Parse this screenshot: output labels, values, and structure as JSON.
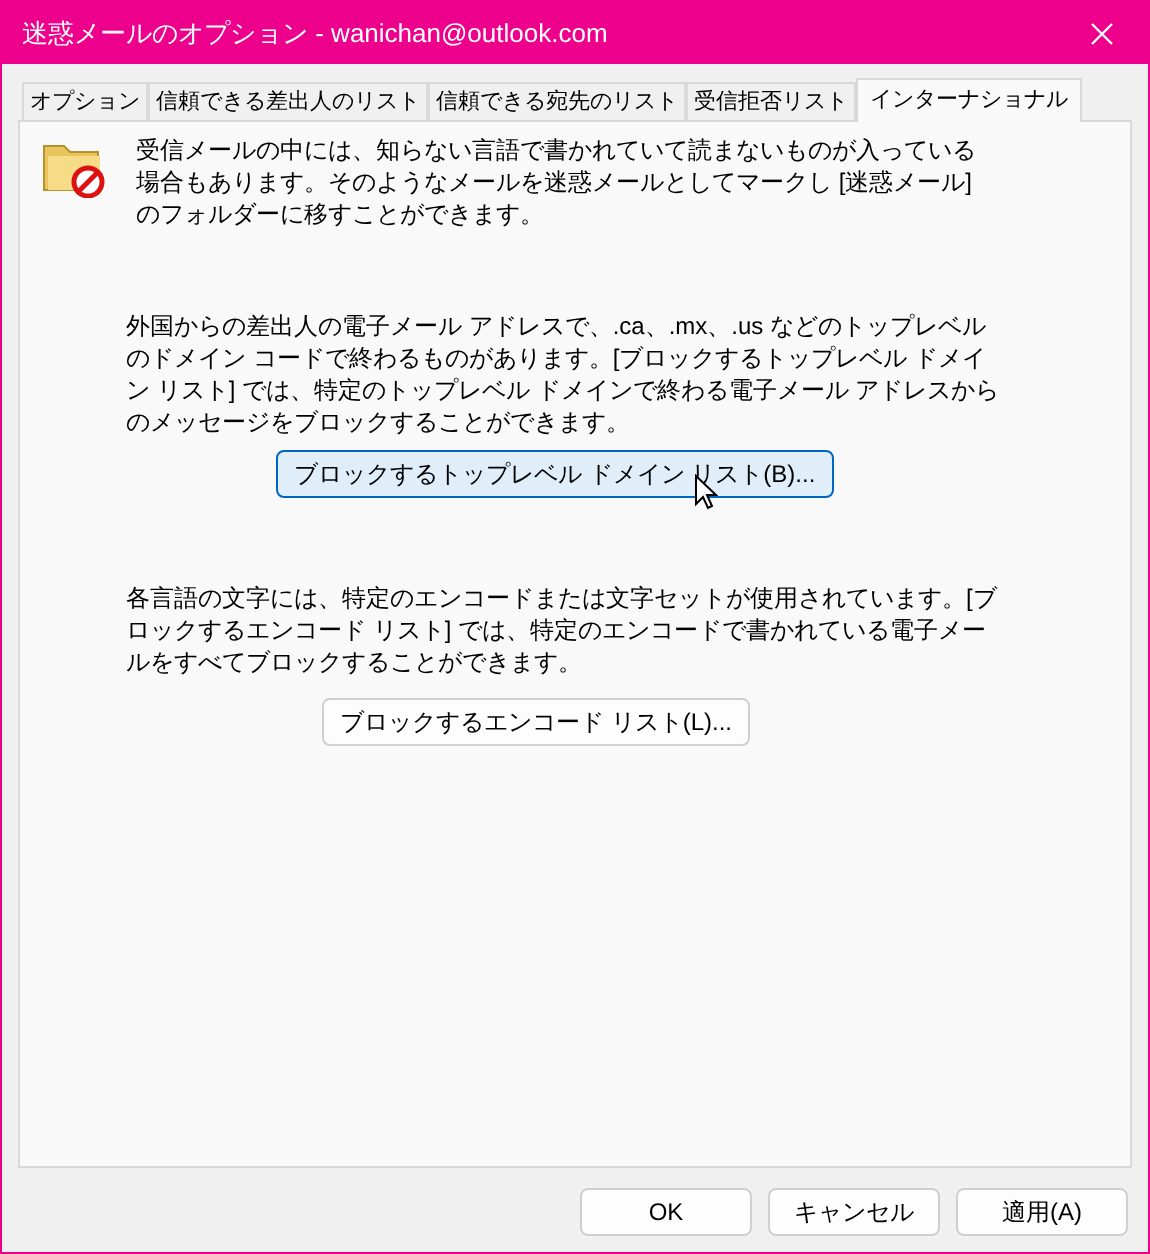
{
  "window": {
    "title": "迷惑メールのオプション - wanichan@outlook.com"
  },
  "tabs": [
    {
      "label": "オプション",
      "selected": false
    },
    {
      "label": "信頼できる差出人のリスト",
      "selected": false
    },
    {
      "label": "信頼できる宛先のリスト",
      "selected": false
    },
    {
      "label": "受信拒否リスト",
      "selected": false
    },
    {
      "label": "インターナショナル",
      "selected": true
    }
  ],
  "intro": "受信メールの中には、知らない言語で書かれていて読まないものが入っている場合もあります。そのようなメールを迷惑メールとしてマークし [迷惑メール] のフォルダーに移すことができます。",
  "sections": [
    {
      "text": "外国からの差出人の電子メール アドレスで、.ca、.mx、.us などのトップレベルのドメイン コードで終わるものがあります。[ブロックするトップレベル ドメイン リスト] では、特定のトップレベル ドメインで終わる電子メール アドレスからのメッセージをブロックすることができます。",
      "button": "ブロックするトップレベル ドメイン リスト(B)...",
      "hovered": true
    },
    {
      "text": "各言語の文字には、特定のエンコードまたは文字セットが使用されています。[ブロックするエンコード リスト] では、特定のエンコードで書かれている電子メールをすべてブロックすることができます。",
      "button": "ブロックするエンコード リスト(L)...",
      "hovered": false
    }
  ],
  "footer_buttons": [
    "OK",
    "キャンセル",
    "適用(A)"
  ]
}
